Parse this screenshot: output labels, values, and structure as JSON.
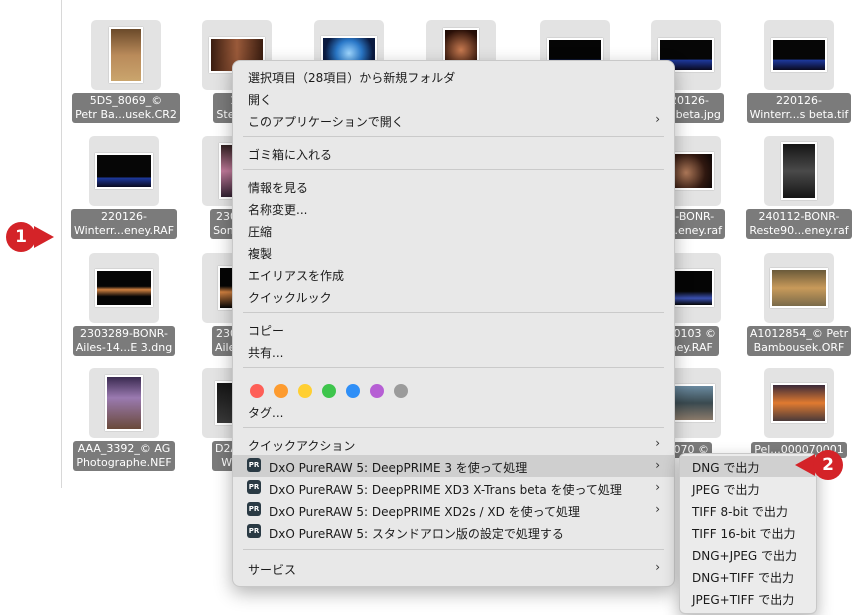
{
  "files": [
    {
      "line1": "5DS_8069_©",
      "line2": "Petr Ba...usek.CR2"
    },
    {
      "line1": "12",
      "line2": "Stefan_"
    },
    {
      "line1": "",
      "line2": ""
    },
    {
      "line1": "",
      "line2": ""
    },
    {
      "line1": "",
      "line2": ""
    },
    {
      "line1": "220126-",
      "line2": "...r...beta.jpg"
    },
    {
      "line1": "220126-",
      "line2": "Winterr...s beta.tif"
    },
    {
      "line1": "220126-",
      "line2": "Winterr...eney.RAF"
    },
    {
      "line1": "230425",
      "line2": "Songs-..."
    },
    {
      "line1": "...2-BONR-",
      "line2": "...1...eney.raf"
    },
    {
      "line1": "240112-BONR-",
      "line2": "Reste90...eney.raf"
    },
    {
      "line1": "2303289-BONR-",
      "line2": "Ailes-14...E 3.dng"
    },
    {
      "line1": "230328",
      "line2": "Ailes-14"
    },
    {
      "line1": "...50103 ©",
      "line2": "...ney.RAF"
    },
    {
      "line1": "A1012854_© Petr",
      "line2": "Bambousek.ORF"
    },
    {
      "line1": "AAA_3392_© AG",
      "line2": "Photographe.NEF"
    },
    {
      "line1": "D2A686",
      "line2": "Wai_L"
    },
    {
      "line1": "...070 ©",
      "line2": ""
    },
    {
      "line1": "Pel...000070001",
      "line2": ""
    }
  ],
  "context_menu": {
    "new_folder": "選択項目（28項目）から新規フォルダ",
    "open": "開く",
    "open_with": "このアプリケーションで開く",
    "trash": "ゴミ箱に入れる",
    "get_info": "情報を見る",
    "rename": "名称変更...",
    "compress": "圧縮",
    "duplicate": "複製",
    "make_alias": "エイリアスを作成",
    "quick_look": "クイックルック",
    "copy": "コピー",
    "share": "共有...",
    "tags": "タグ...",
    "quick_actions": "クイックアクション",
    "dxo_1": "DxO PureRAW 5: DeepPRIME 3 を使って処理",
    "dxo_2": "DxO PureRAW 5: DeepPRIME XD3 X-Trans beta を使って処理",
    "dxo_3": "DxO PureRAW 5: DeepPRIME XD2s / XD を使って処理",
    "dxo_4": "DxO PureRAW 5: スタンドアロン版の設定で処理する",
    "services": "サービス",
    "dxo_icon_text": "PR",
    "tag_colors": [
      "#fe5f57",
      "#fd9b2f",
      "#ffcf32",
      "#3ec54c",
      "#2f8ff7",
      "#b65fd4",
      "#9b9b9b"
    ],
    "submenu_arrow": "›"
  },
  "submenu": {
    "items": [
      "DNG で出力",
      "JPEG で出力",
      "TIFF 8-bit で出力",
      "TIFF 16-bit で出力",
      "DNG+JPEG で出力",
      "DNG+TIFF で出力",
      "JPEG+TIFF で出力"
    ]
  },
  "badges": {
    "one": "1",
    "two": "2",
    "color": "#d42328"
  }
}
